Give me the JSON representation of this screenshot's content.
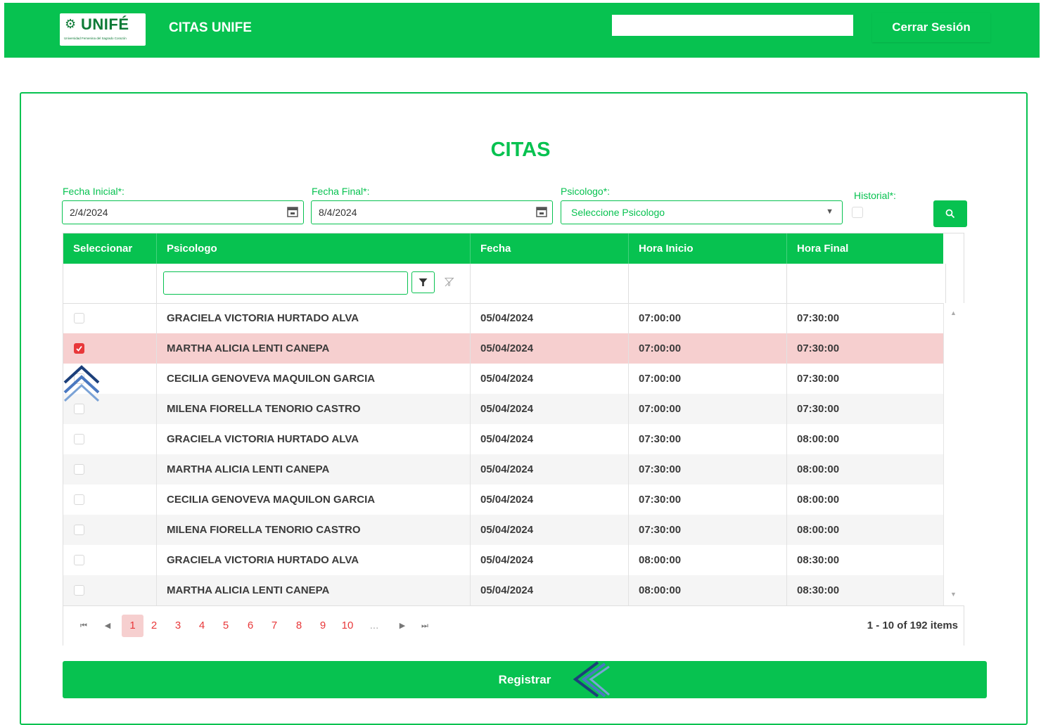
{
  "header": {
    "logo_text": "UNIFÉ",
    "logo_subtext": "Universidad Femenina del Sagrado Corazón",
    "app_title": "CITAS UNIFE",
    "search_value": "",
    "logout_label": "Cerrar Sesión"
  },
  "page": {
    "title": "CITAS"
  },
  "filters": {
    "start_date_label": "Fecha Inicial*:",
    "start_date_value": "2/4/2024",
    "end_date_label": "Fecha Final*:",
    "end_date_value": "8/4/2024",
    "psychologist_label": "Psicologo*:",
    "psychologist_value": "Seleccione Psicologo",
    "history_label": "Historial*:"
  },
  "grid": {
    "columns": [
      "Seleccionar",
      "Psicologo",
      "Fecha",
      "Hora Inicio",
      "Hora Final"
    ],
    "filter_value": "",
    "rows": [
      {
        "checked": false,
        "psicologo": "GRACIELA VICTORIA HURTADO ALVA",
        "fecha": "05/04/2024",
        "inicio": "07:00:00",
        "final": "07:30:00"
      },
      {
        "checked": true,
        "psicologo": "MARTHA ALICIA LENTI CANEPA",
        "fecha": "05/04/2024",
        "inicio": "07:00:00",
        "final": "07:30:00"
      },
      {
        "checked": false,
        "psicologo": "CECILIA GENOVEVA MAQUILON GARCIA",
        "fecha": "05/04/2024",
        "inicio": "07:00:00",
        "final": "07:30:00"
      },
      {
        "checked": false,
        "psicologo": "MILENA FIORELLA TENORIO CASTRO",
        "fecha": "05/04/2024",
        "inicio": "07:00:00",
        "final": "07:30:00"
      },
      {
        "checked": false,
        "psicologo": "GRACIELA VICTORIA HURTADO ALVA",
        "fecha": "05/04/2024",
        "inicio": "07:30:00",
        "final": "08:00:00"
      },
      {
        "checked": false,
        "psicologo": "MARTHA ALICIA LENTI CANEPA",
        "fecha": "05/04/2024",
        "inicio": "07:30:00",
        "final": "08:00:00"
      },
      {
        "checked": false,
        "psicologo": "CECILIA GENOVEVA MAQUILON GARCIA",
        "fecha": "05/04/2024",
        "inicio": "07:30:00",
        "final": "08:00:00"
      },
      {
        "checked": false,
        "psicologo": "MILENA FIORELLA TENORIO CASTRO",
        "fecha": "05/04/2024",
        "inicio": "07:30:00",
        "final": "08:00:00"
      },
      {
        "checked": false,
        "psicologo": "GRACIELA VICTORIA HURTADO ALVA",
        "fecha": "05/04/2024",
        "inicio": "08:00:00",
        "final": "08:30:00"
      },
      {
        "checked": false,
        "psicologo": "MARTHA ALICIA LENTI CANEPA",
        "fecha": "05/04/2024",
        "inicio": "08:00:00",
        "final": "08:30:00"
      }
    ]
  },
  "pager": {
    "pages": [
      "1",
      "2",
      "3",
      "4",
      "5",
      "6",
      "7",
      "8",
      "9",
      "10",
      "..."
    ],
    "current_page": "1",
    "info": "1 - 10 of 192 items"
  },
  "actions": {
    "register_label": "Registrar"
  },
  "colors": {
    "primary": "#07c250",
    "selected_row": "#f6cfcf",
    "checkbox_checked": "#e8383a",
    "pager_link": "#e8383a"
  },
  "icons": [
    "calendar-icon",
    "dropdown-arrow-icon",
    "search-icon",
    "filter-icon",
    "clear-filter-icon",
    "scroll-up-icon",
    "scroll-down-icon",
    "first-page-icon",
    "prev-page-icon",
    "next-page-icon",
    "last-page-icon",
    "checkmark-icon",
    "double-chevron-up-icon",
    "double-chevron-left-icon"
  ]
}
